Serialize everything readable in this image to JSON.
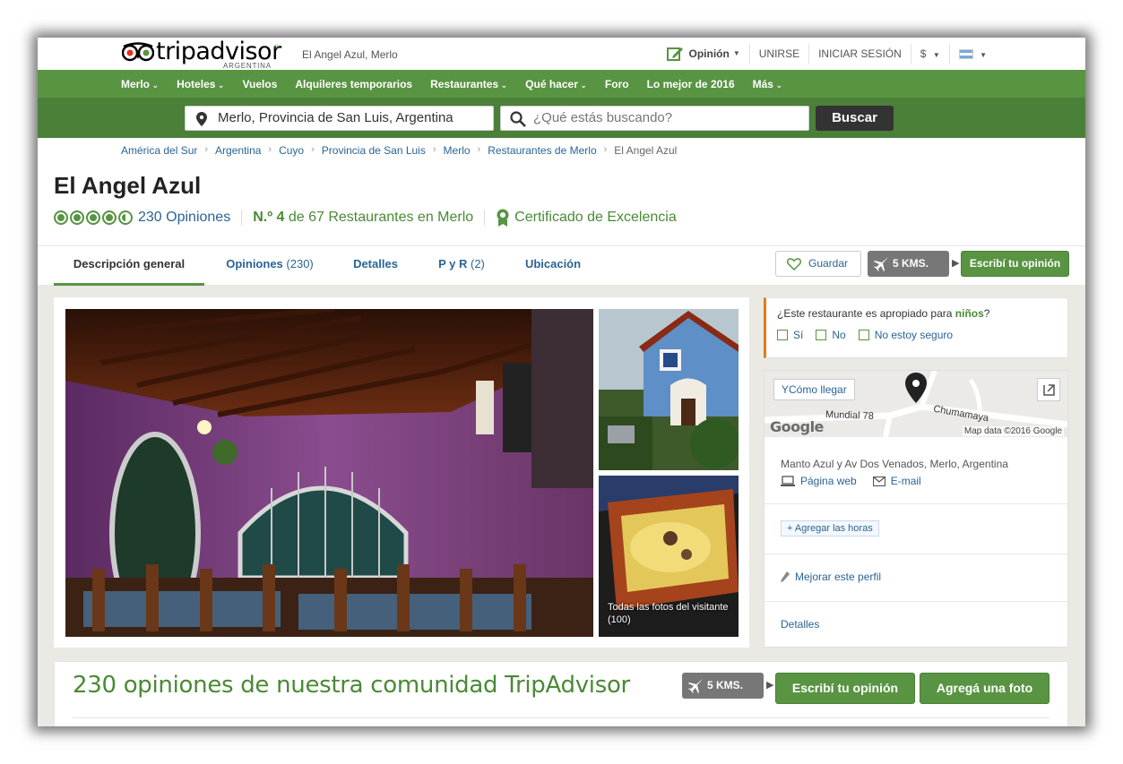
{
  "header": {
    "logo_text": "tripadvisor",
    "logo_sub": "ARGENTINA",
    "logo_reg": "®",
    "place": "El Angel Azul, Merlo",
    "opinion": "Opinión",
    "join": "UNIRSE",
    "login": "INICIAR SESIÓN",
    "currency": "$"
  },
  "nav": {
    "items": [
      "Merlo",
      "Hoteles",
      "Vuelos",
      "Alquileres temporarios",
      "Restaurantes",
      "Qué hacer",
      "Foro",
      "Lo mejor de 2016",
      "Más"
    ]
  },
  "search": {
    "location_value": "Merlo, Provincia de San Luis, Argentina",
    "query_placeholder": "¿Qué estás buscando?",
    "button": "Buscar"
  },
  "breadcrumb": [
    "América del Sur",
    "Argentina",
    "Cuyo",
    "Provincia de San Luis",
    "Merlo",
    "Restaurantes de Merlo",
    "El Angel Azul"
  ],
  "restaurant": {
    "name": "El Angel Azul",
    "rating": 4.5,
    "reviews_label": "230 Opiniones",
    "rank_prefix": "N.º 4",
    "rank_suffix": "de 67 Restaurantes en Merlo",
    "certificate": "Certificado de Excelencia"
  },
  "tabs": {
    "overview": "Descripción general",
    "reviews": "Opiniones",
    "reviews_count": "(230)",
    "details": "Detalles",
    "qa": "P y R",
    "qa_count": "(2)",
    "location": "Ubicación"
  },
  "actions": {
    "save": "Guardar",
    "km": "5 KMS.",
    "write_review": "Escribí tu opinión"
  },
  "photos": {
    "caption": "Todas las fotos del visitante",
    "count": "(100)"
  },
  "kids": {
    "question_prefix": "¿Este restaurante es apropiado para ",
    "question_bold": "niños",
    "question_suffix": "?",
    "options": [
      "Sí",
      "No",
      "No estoy seguro"
    ]
  },
  "info": {
    "directions": "Cómo llegar",
    "street1": "Mundial 78",
    "street2": "Chumamaya",
    "google": "Google",
    "map_data": "Map data ©2016 Google",
    "address": "Manto Azul y Av Dos Venados, Merlo, Argentina",
    "website": "Página web",
    "email": "E-mail",
    "add_hours": "+ Agregar las horas",
    "improve": "Mejorar este perfil",
    "details": "Detalles"
  },
  "reviews_section": {
    "title": "230 opiniones de nuestra comunidad TripAdvisor",
    "km": "5 KMS.",
    "write_review": "Escribí tu opinión",
    "add_photo": "Agregá una foto"
  },
  "colors": {
    "brand_green": "#589442",
    "dark_green": "#4a8038",
    "link_blue": "#2a6496",
    "kids_accent": "#e07b1a"
  }
}
